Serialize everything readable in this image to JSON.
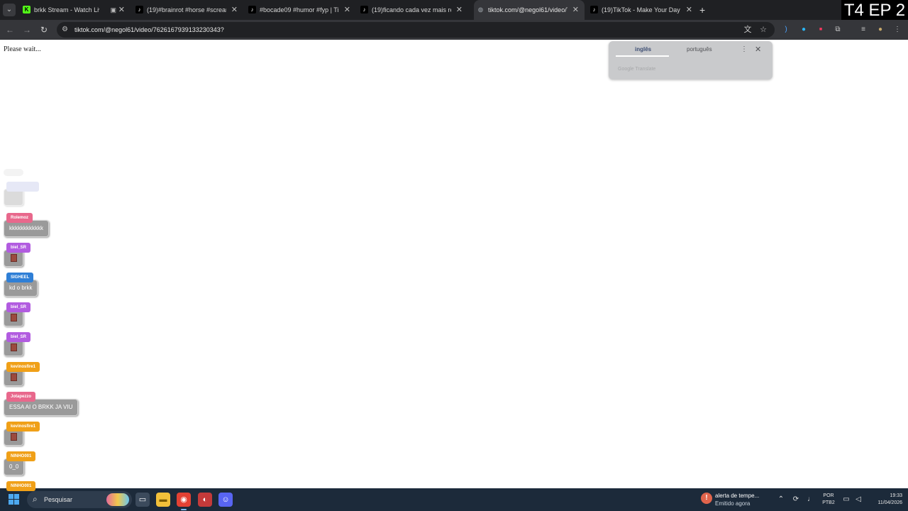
{
  "tabs": [
    {
      "title": "brkk Stream - Watch Live o",
      "favicon": "kick-icon",
      "color": "#53fc18"
    },
    {
      "title": "(19)#brainrot #horse #scream |",
      "favicon": "tiktok-icon",
      "color": "#000000"
    },
    {
      "title": "#bocade09 #humor #fyp | TikT",
      "favicon": "tiktok-icon",
      "color": "#000000"
    },
    {
      "title": "(19)ficando cada vez mais realis",
      "favicon": "tiktok-icon",
      "color": "#000000"
    },
    {
      "title": "tiktok.com/@negol61/video/7",
      "favicon": "globe-icon",
      "color": "#9aa0a6",
      "active": true
    },
    {
      "title": "(19)TikTok - Make Your Day",
      "favicon": "tiktok-icon",
      "color": "#000000"
    }
  ],
  "overlay_label": "T4 EP 2",
  "address_bar": {
    "url": "tiktok.com/@negol61/video/7626167939133230343?"
  },
  "page": {
    "message": "Please wait..."
  },
  "translate_popup": {
    "source_lang": "inglês",
    "target_lang": "português",
    "footer": "Google Translate"
  },
  "chat": [
    {
      "user": "Rolemoz",
      "text": "kkkkkkkkkkkk",
      "color": "#e8688c"
    },
    {
      "user": "biel_SR",
      "text": "",
      "color": "#b25ce0",
      "emote": true
    },
    {
      "user": "SIGHEEL",
      "text": "kd o brkk",
      "color": "#2f7fd6"
    },
    {
      "user": "biel_SR",
      "text": "",
      "color": "#b25ce0",
      "emote": true
    },
    {
      "user": "biel_SR",
      "text": "",
      "color": "#b25ce0",
      "emote": true
    },
    {
      "user": "kevinosfire1",
      "text": "",
      "color": "#f0a018",
      "emote": true
    },
    {
      "user": "Jotapezzo",
      "text": "ESSA AI O BRKK JA VIU",
      "color": "#e8688c"
    },
    {
      "user": "kevinosfire1",
      "text": "",
      "color": "#f0a018",
      "emote": true
    },
    {
      "user": "NINHO001",
      "text": "0_0",
      "color": "#f0a018"
    },
    {
      "user": "NINHO001",
      "text": "",
      "color": "#f0a018"
    }
  ],
  "taskbar": {
    "search_placeholder": "Pesquisar",
    "weather_title": "alerta de tempe...",
    "weather_sub": "Emitido agora",
    "lang_top": "POR",
    "lang_bottom": "PTB2",
    "time": "19:33",
    "date": "11/04/2026"
  }
}
